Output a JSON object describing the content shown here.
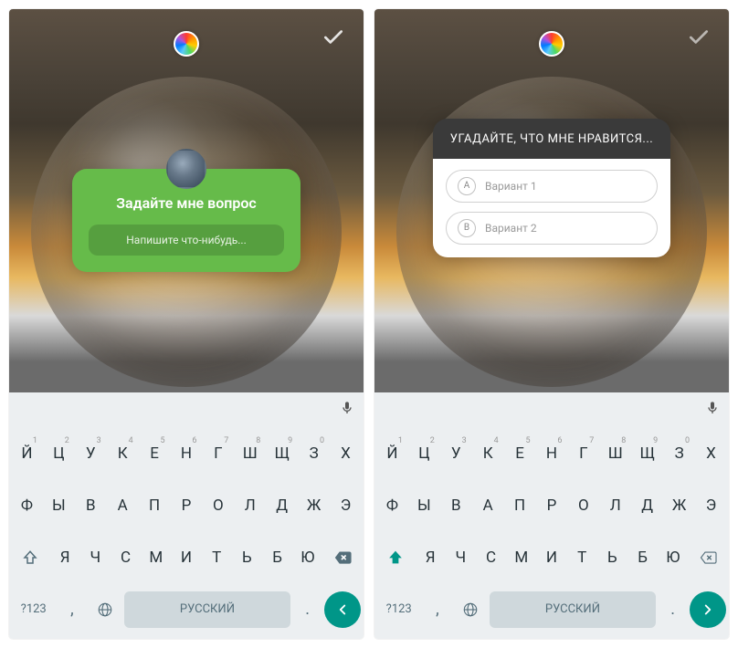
{
  "left": {
    "question_sticker": {
      "title": "Задайте мне вопрос",
      "placeholder": "Напишите что-нибудь..."
    },
    "keyboard": {
      "layout_label": "Русский",
      "symbols_label": "?123",
      "shift_active": false,
      "row1": [
        {
          "c": "й",
          "n": "1"
        },
        {
          "c": "ц",
          "n": "2"
        },
        {
          "c": "у",
          "n": "3"
        },
        {
          "c": "к",
          "n": "4"
        },
        {
          "c": "е",
          "n": "5"
        },
        {
          "c": "н",
          "n": "6"
        },
        {
          "c": "г",
          "n": "7"
        },
        {
          "c": "ш",
          "n": "8"
        },
        {
          "c": "щ",
          "n": "9"
        },
        {
          "c": "з",
          "n": "0"
        },
        {
          "c": "х",
          "n": ""
        }
      ],
      "row2": [
        {
          "c": "ф"
        },
        {
          "c": "ы"
        },
        {
          "c": "в"
        },
        {
          "c": "а"
        },
        {
          "c": "п"
        },
        {
          "c": "р"
        },
        {
          "c": "о"
        },
        {
          "c": "л"
        },
        {
          "c": "д"
        },
        {
          "c": "ж"
        },
        {
          "c": "э"
        }
      ],
      "row3": [
        {
          "c": "я"
        },
        {
          "c": "ч"
        },
        {
          "c": "с"
        },
        {
          "c": "м"
        },
        {
          "c": "и"
        },
        {
          "c": "т"
        },
        {
          "c": "ь"
        },
        {
          "c": "б"
        },
        {
          "c": "ю"
        }
      ]
    }
  },
  "right": {
    "quiz_sticker": {
      "title": "УГАДАЙТЕ, ЧТО МНЕ НРАВИТСЯ...",
      "option_a_letter": "A",
      "option_a_label": "Вариант 1",
      "option_b_letter": "B",
      "option_b_label": "Вариант 2"
    },
    "keyboard": {
      "layout_label": "Русский",
      "symbols_label": "?123",
      "shift_active": true,
      "row1": [
        {
          "c": "Й",
          "n": "1"
        },
        {
          "c": "Ц",
          "n": "2"
        },
        {
          "c": "У",
          "n": "3"
        },
        {
          "c": "К",
          "n": "4"
        },
        {
          "c": "Е",
          "n": "5"
        },
        {
          "c": "Н",
          "n": "6"
        },
        {
          "c": "Г",
          "n": "7"
        },
        {
          "c": "Ш",
          "n": "8"
        },
        {
          "c": "Щ",
          "n": "9"
        },
        {
          "c": "З",
          "n": "0"
        },
        {
          "c": "Х",
          "n": ""
        }
      ],
      "row2": [
        {
          "c": "Ф"
        },
        {
          "c": "Ы"
        },
        {
          "c": "В"
        },
        {
          "c": "А"
        },
        {
          "c": "П"
        },
        {
          "c": "Р"
        },
        {
          "c": "О"
        },
        {
          "c": "Л"
        },
        {
          "c": "Д"
        },
        {
          "c": "Ж"
        },
        {
          "c": "Э"
        }
      ],
      "row3": [
        {
          "c": "Я"
        },
        {
          "c": "Ч"
        },
        {
          "c": "С"
        },
        {
          "c": "М"
        },
        {
          "c": "И"
        },
        {
          "c": "Т"
        },
        {
          "c": "Ь"
        },
        {
          "c": "Б"
        },
        {
          "c": "Ю"
        }
      ]
    }
  }
}
